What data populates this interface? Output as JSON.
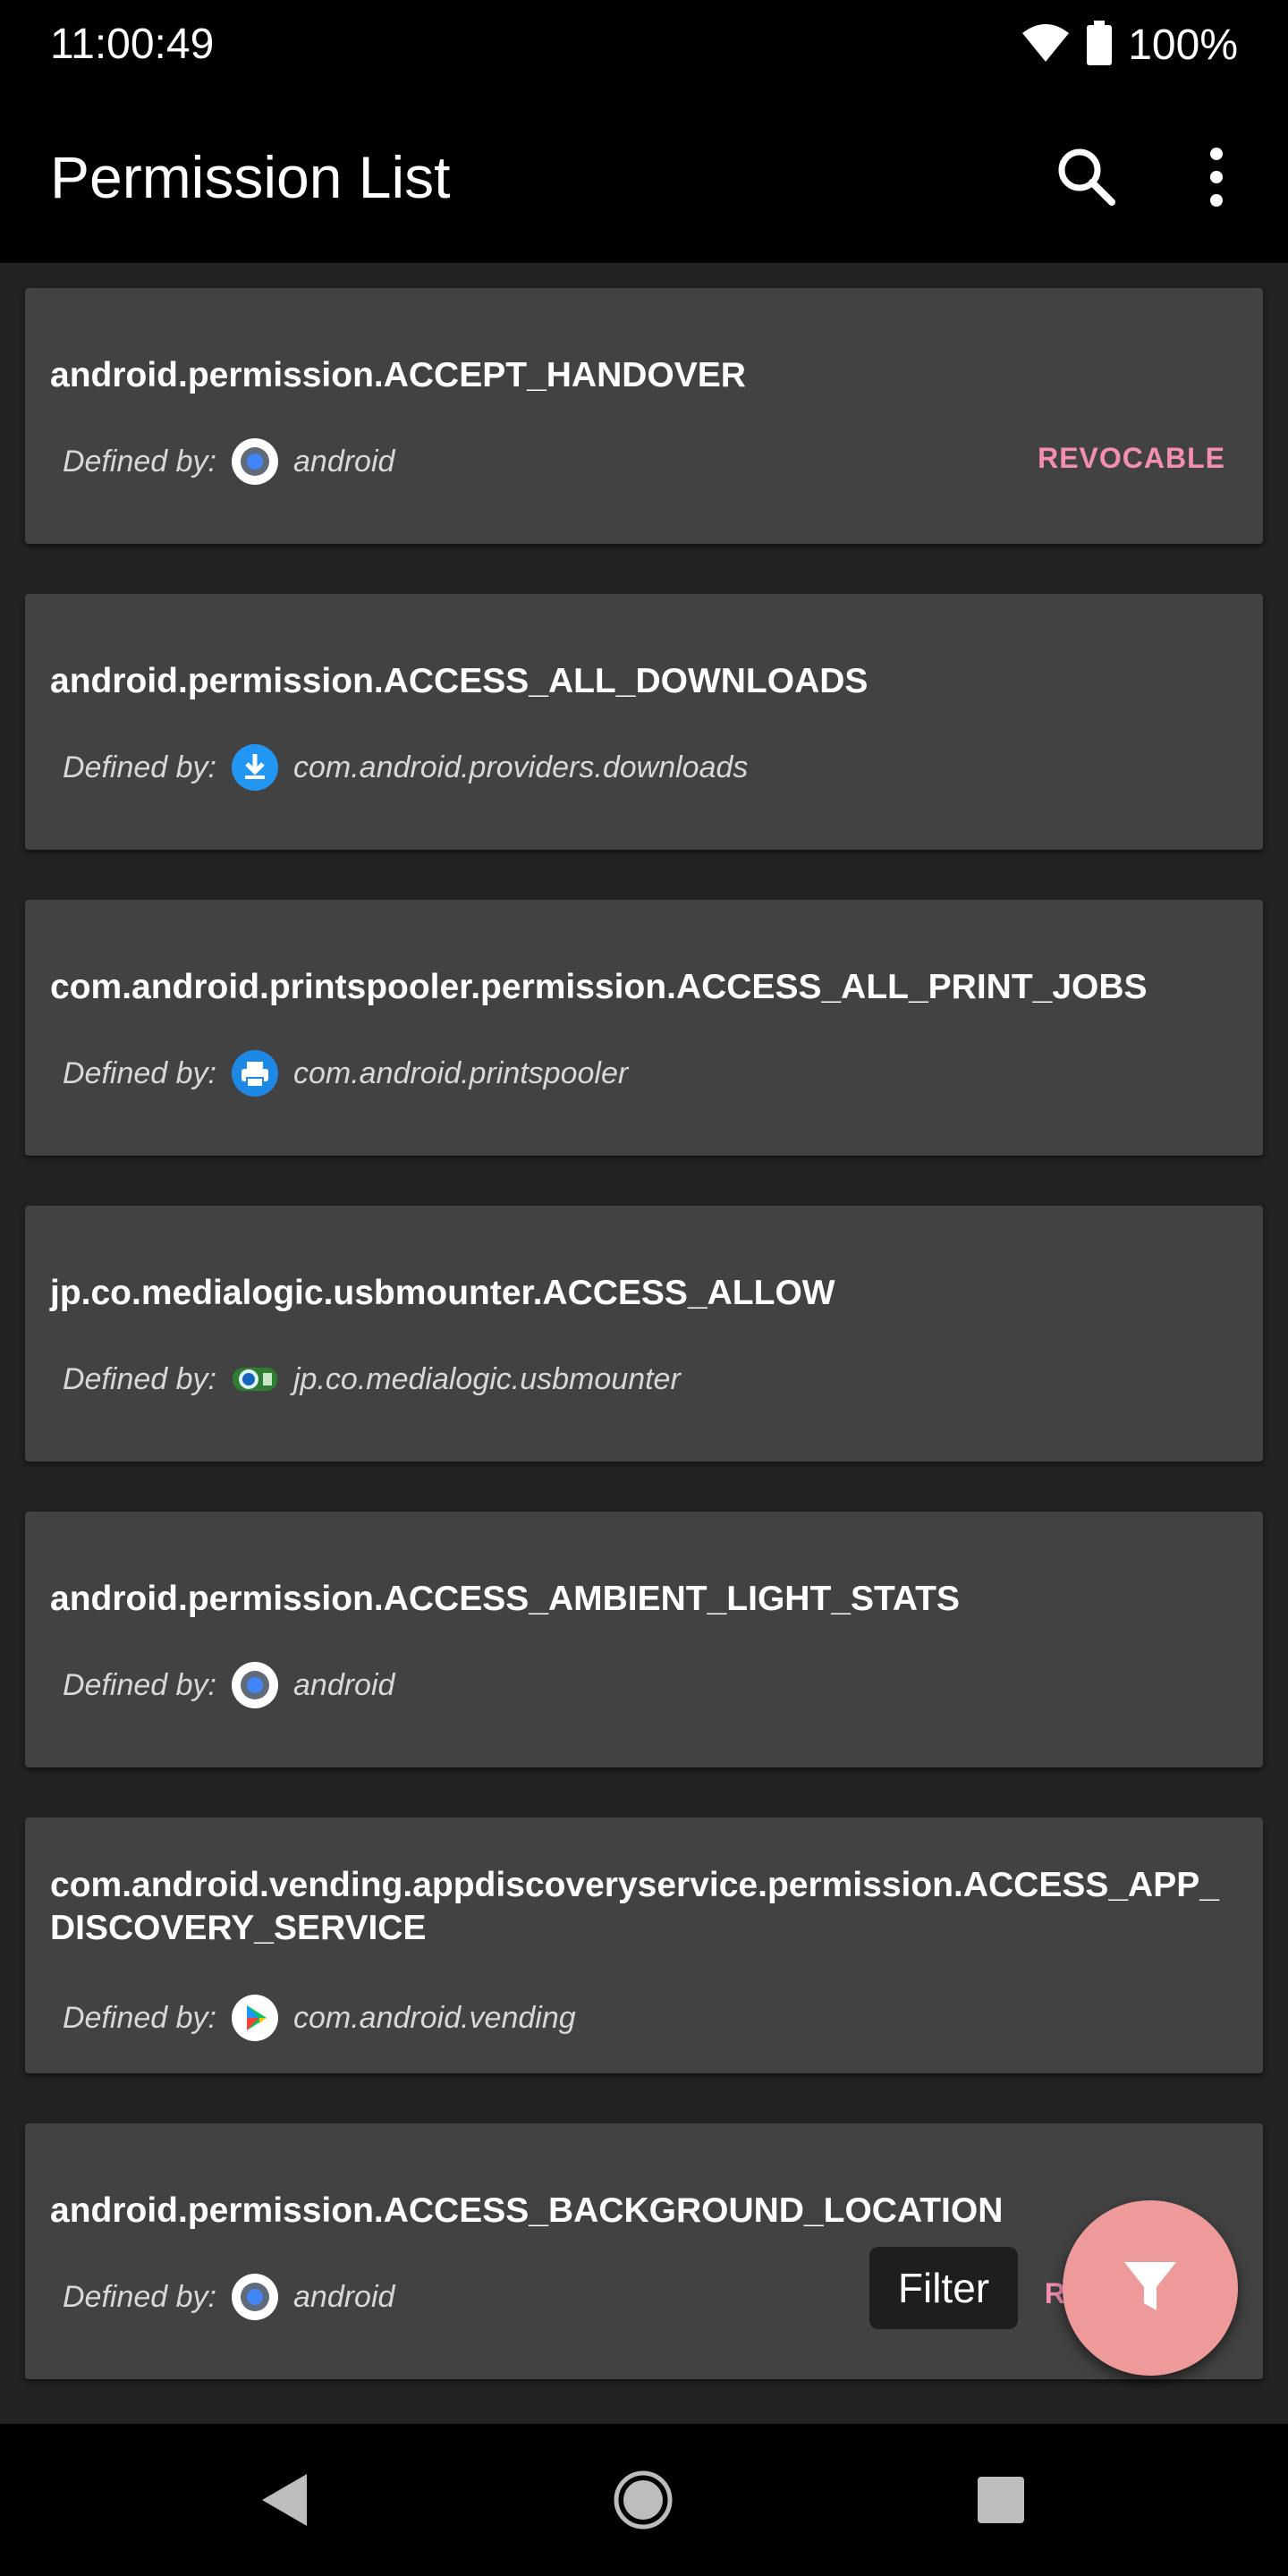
{
  "status_bar": {
    "time": "11:00:49",
    "battery": "100%"
  },
  "app_bar": {
    "title": "Permission List"
  },
  "labels": {
    "defined_by": "Defined by:"
  },
  "permissions": [
    {
      "name": "android.permission.ACCEPT_HANDOVER",
      "package": "android",
      "icon": "android-system-icon",
      "tag": "REVOCABLE"
    },
    {
      "name": "android.permission.ACCESS_ALL_DOWNLOADS",
      "package": "com.android.providers.downloads",
      "icon": "download-icon",
      "tag": ""
    },
    {
      "name": "com.android.printspooler.permission.ACCESS_ALL_PRINT_JOBS",
      "package": "com.android.printspooler",
      "icon": "printer-icon",
      "tag": ""
    },
    {
      "name": "jp.co.medialogic.usbmounter.ACCESS_ALLOW",
      "package": "jp.co.medialogic.usbmounter",
      "icon": "usb-mounter-icon",
      "tag": ""
    },
    {
      "name": "android.permission.ACCESS_AMBIENT_LIGHT_STATS",
      "package": "android",
      "icon": "android-system-icon",
      "tag": ""
    },
    {
      "name": "com.android.vending.appdiscoveryservice.permission.ACCESS_APP_DISCOVERY_SERVICE",
      "package": "com.android.vending",
      "icon": "play-store-icon",
      "tag": ""
    },
    {
      "name": "android.permission.ACCESS_BACKGROUND_LOCATION",
      "package": "android",
      "icon": "android-system-icon",
      "tag": "R"
    }
  ],
  "fab": {
    "tooltip": "Filter",
    "icon": "filter-icon"
  },
  "colors": {
    "accent": "#f48fb1",
    "fab": "#ef9a9a",
    "card": "#424242",
    "background": "#222222"
  }
}
